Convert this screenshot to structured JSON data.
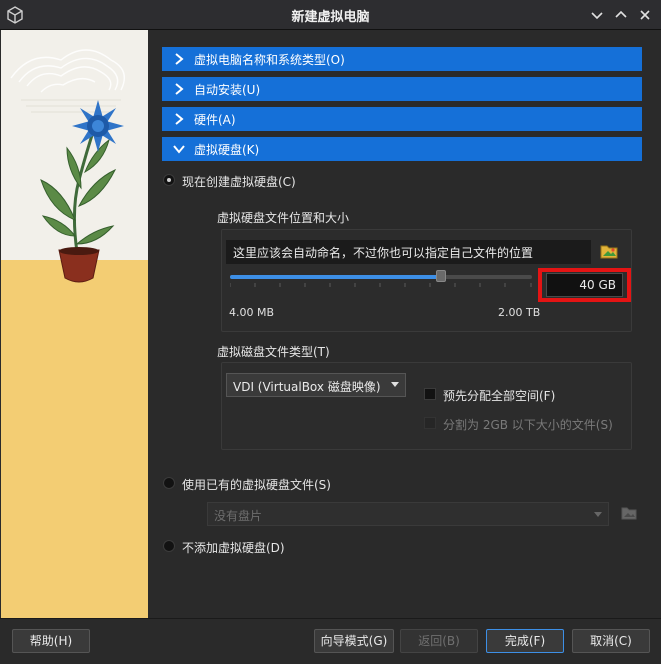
{
  "window": {
    "title": "新建虚拟电脑",
    "app_icon": "virtualbox-cube-icon",
    "controls": [
      "chevron-down-icon",
      "chevron-up-icon",
      "close-icon"
    ]
  },
  "sections": [
    {
      "label": "虚拟电脑名称和系统类型(O)",
      "expanded": false
    },
    {
      "label": "自动安装(U)",
      "expanded": false
    },
    {
      "label": "硬件(A)",
      "expanded": false
    },
    {
      "label": "虚拟硬盘(K)",
      "expanded": true
    }
  ],
  "disk": {
    "create_new_label": "现在创建虚拟硬盘(C)",
    "create_new_selected": true,
    "location_group_label": "虚拟硬盘文件位置和大小",
    "location_value": "这里应该会自动命名，不过你也可以指定自己文件的位置",
    "size_value": "40 GB",
    "size_fraction": 0.7,
    "size_min_label": "4.00 MB",
    "size_max_label": "2.00 TB",
    "type_group_label": "虚拟磁盘文件类型(T)",
    "type_value": "VDI (VirtualBox 磁盘映像)",
    "preallocate_label": "预先分配全部空间(F)",
    "preallocate_checked": false,
    "split_label": "分割为 2GB 以下大小的文件(S)",
    "split_checked": false,
    "use_existing_label": "使用已有的虚拟硬盘文件(S)",
    "existing_placeholder": "没有盘片",
    "no_disk_label": "不添加虚拟硬盘(D)"
  },
  "footer": {
    "help": "帮助(H)",
    "guided_mode": "向导模式(G)",
    "back": "返回(B)",
    "finish": "完成(F)",
    "cancel": "取消(C)"
  },
  "colors": {
    "section_blue": "#1570d8",
    "highlight_red": "#e41414",
    "slider_blue": "#3d8fe6"
  }
}
